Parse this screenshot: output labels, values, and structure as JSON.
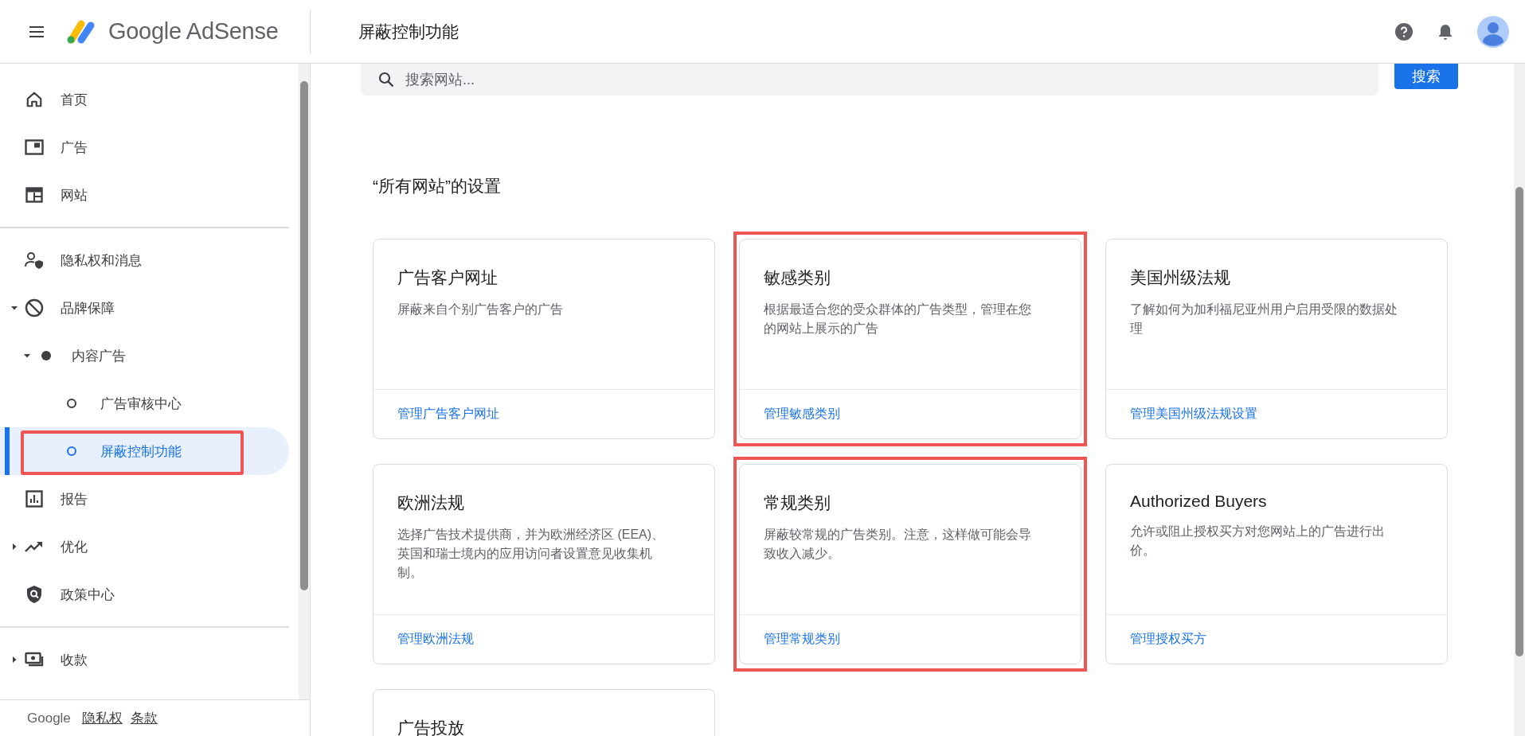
{
  "header": {
    "product": "Google AdSense",
    "page_title": "屏蔽控制功能"
  },
  "sidebar": {
    "groups": [
      {
        "items": [
          {
            "label": "首页",
            "selected": false,
            "highlighted": false
          },
          {
            "label": "广告",
            "selected": false,
            "highlighted": false
          },
          {
            "label": "网站",
            "selected": false,
            "highlighted": false
          }
        ]
      },
      {
        "items": [
          {
            "label": "隐私权和消息",
            "selected": false,
            "highlighted": false
          },
          {
            "label": "品牌保障",
            "selected": false,
            "highlighted": false,
            "expanded": true,
            "children": [
              {
                "label": "内容广告",
                "selected": false,
                "highlighted": false,
                "expanded": true,
                "children": [
                  {
                    "label": "广告审核中心",
                    "selected": false,
                    "highlighted": false
                  },
                  {
                    "label": "屏蔽控制功能",
                    "selected": true,
                    "highlighted": true
                  }
                ]
              }
            ]
          },
          {
            "label": "报告",
            "selected": false,
            "highlighted": false
          },
          {
            "label": "优化",
            "selected": false,
            "highlighted": false,
            "expanded": false
          },
          {
            "label": "政策中心",
            "selected": false,
            "highlighted": false
          }
        ]
      },
      {
        "items": [
          {
            "label": "收款",
            "selected": false,
            "highlighted": false,
            "expanded": false
          }
        ]
      }
    ],
    "footer": {
      "brand": "Google",
      "links": [
        "隐私权",
        "条款"
      ]
    }
  },
  "search": {
    "placeholder": "搜索网站...",
    "button": "搜索"
  },
  "section_title": "“所有网站”的设置",
  "cards": [
    {
      "title": "广告客户网址",
      "description": "屏蔽来自个别广告客户的广告",
      "link": "管理广告客户网址",
      "highlighted": false
    },
    {
      "title": "敏感类别",
      "description": "根据最适合您的受众群体的广告类型，管理在您的网站上展示的广告",
      "link": "管理敏感类别",
      "highlighted": true
    },
    {
      "title": "美国州级法规",
      "description": "了解如何为加利福尼亚州用户启用受限的数据处理",
      "link": "管理美国州级法规设置",
      "highlighted": false
    },
    {
      "title": "欧洲法规",
      "description": "选择广告技术提供商，并为欧洲经济区 (EEA)、英国和瑞士境内的应用访问者设置意见收集机制。",
      "link": "管理欧洲法规",
      "highlighted": false
    },
    {
      "title": "常规类别",
      "description": "屏蔽较常规的广告类别。注意，这样做可能会导致收入减少。",
      "link": "管理常规类别",
      "highlighted": true
    },
    {
      "title": "Authorized Buyers",
      "description": "允许或阻止授权买方对您网站上的广告进行出价。",
      "link": "管理授权买方",
      "highlighted": false
    },
    {
      "title": "广告投放"
    }
  ]
}
